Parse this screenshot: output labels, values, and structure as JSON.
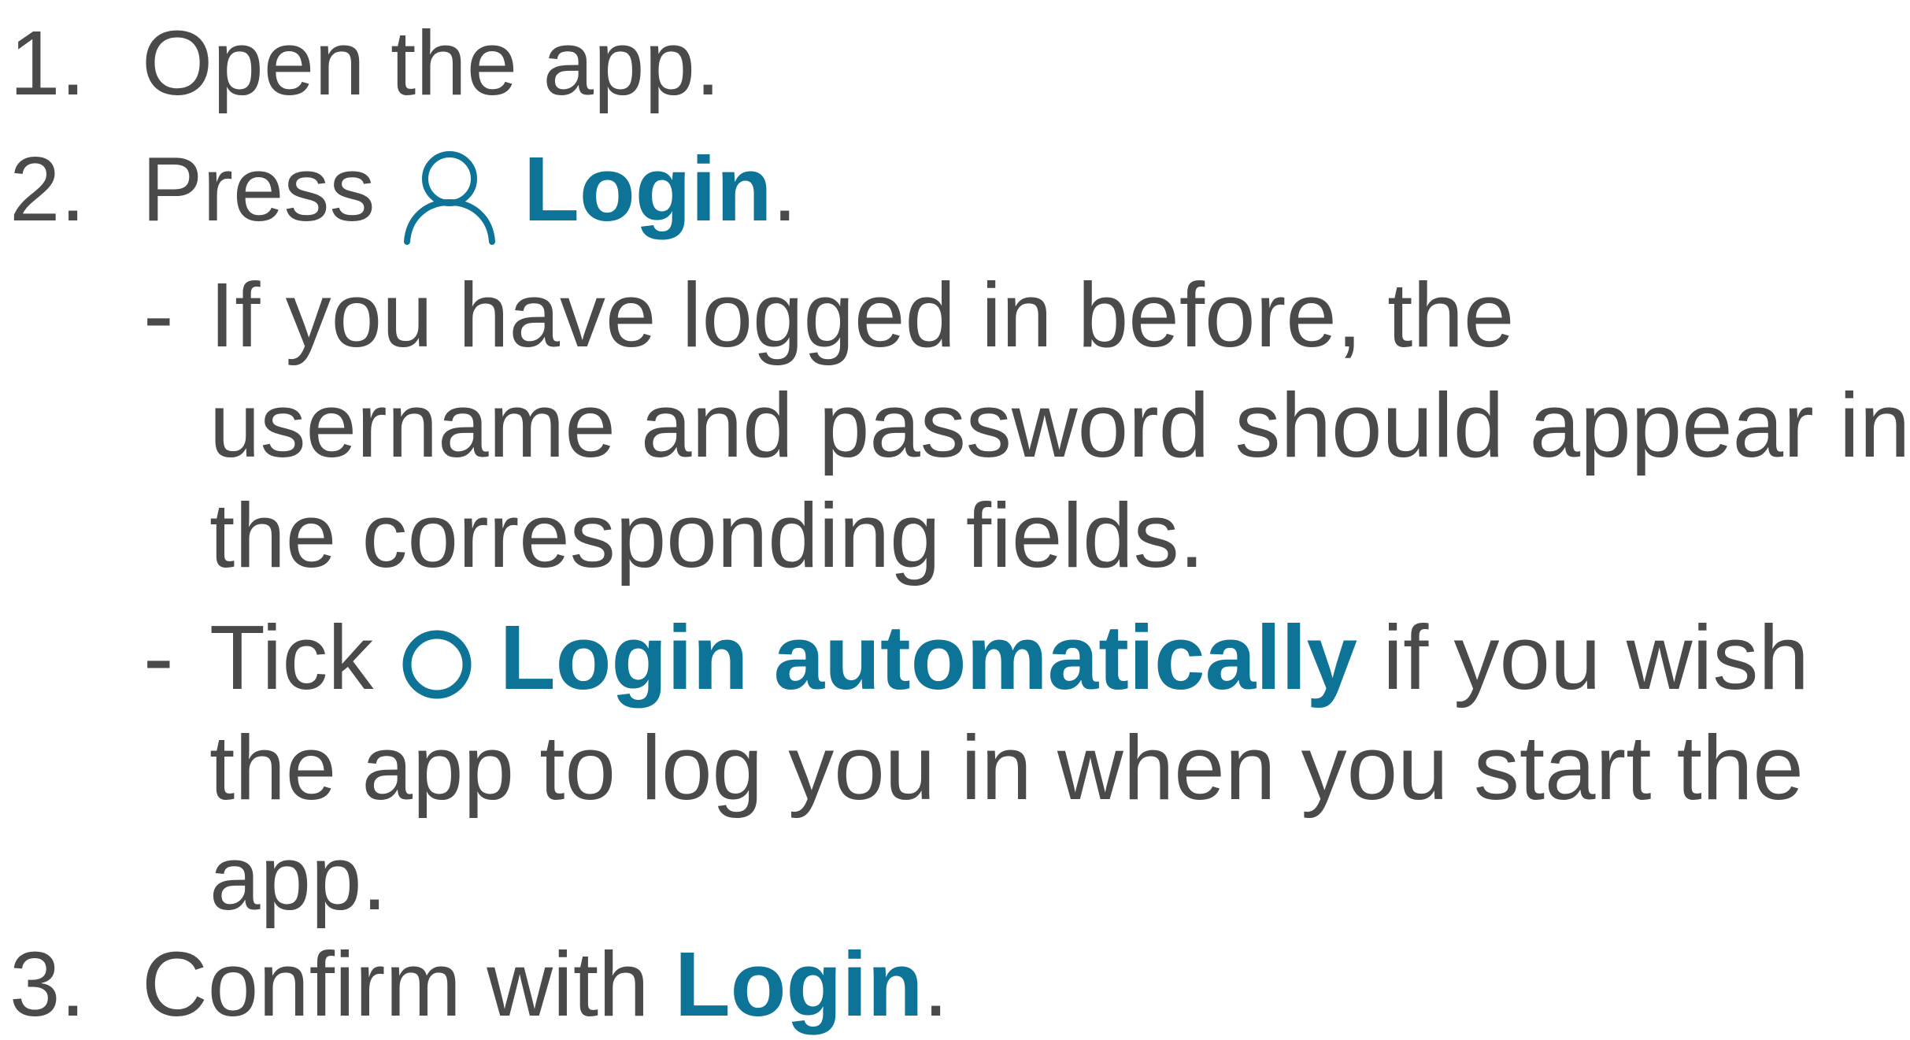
{
  "steps": [
    {
      "number": "1.",
      "text": "Open the app."
    },
    {
      "number": "2.",
      "prefix": "Press",
      "icon": "user-icon",
      "label": "Login",
      "suffix": "."
    },
    {
      "number": "3.",
      "prefix": "Confirm with",
      "label": "Login",
      "suffix": "."
    }
  ],
  "substeps": [
    {
      "dash": "-",
      "lines": [
        "If you have logged in before, the",
        "username and password should appear in",
        "the corresponding fields."
      ]
    },
    {
      "dash": "-",
      "prefix": "Tick",
      "icon": "circle-icon",
      "label": "Login automatically",
      "suffix": "if you wish",
      "lines": [
        "the app to log you in when you start the",
        "app."
      ]
    }
  ],
  "colors": {
    "text": "#4a4a4a",
    "accent": "#0e7497"
  }
}
